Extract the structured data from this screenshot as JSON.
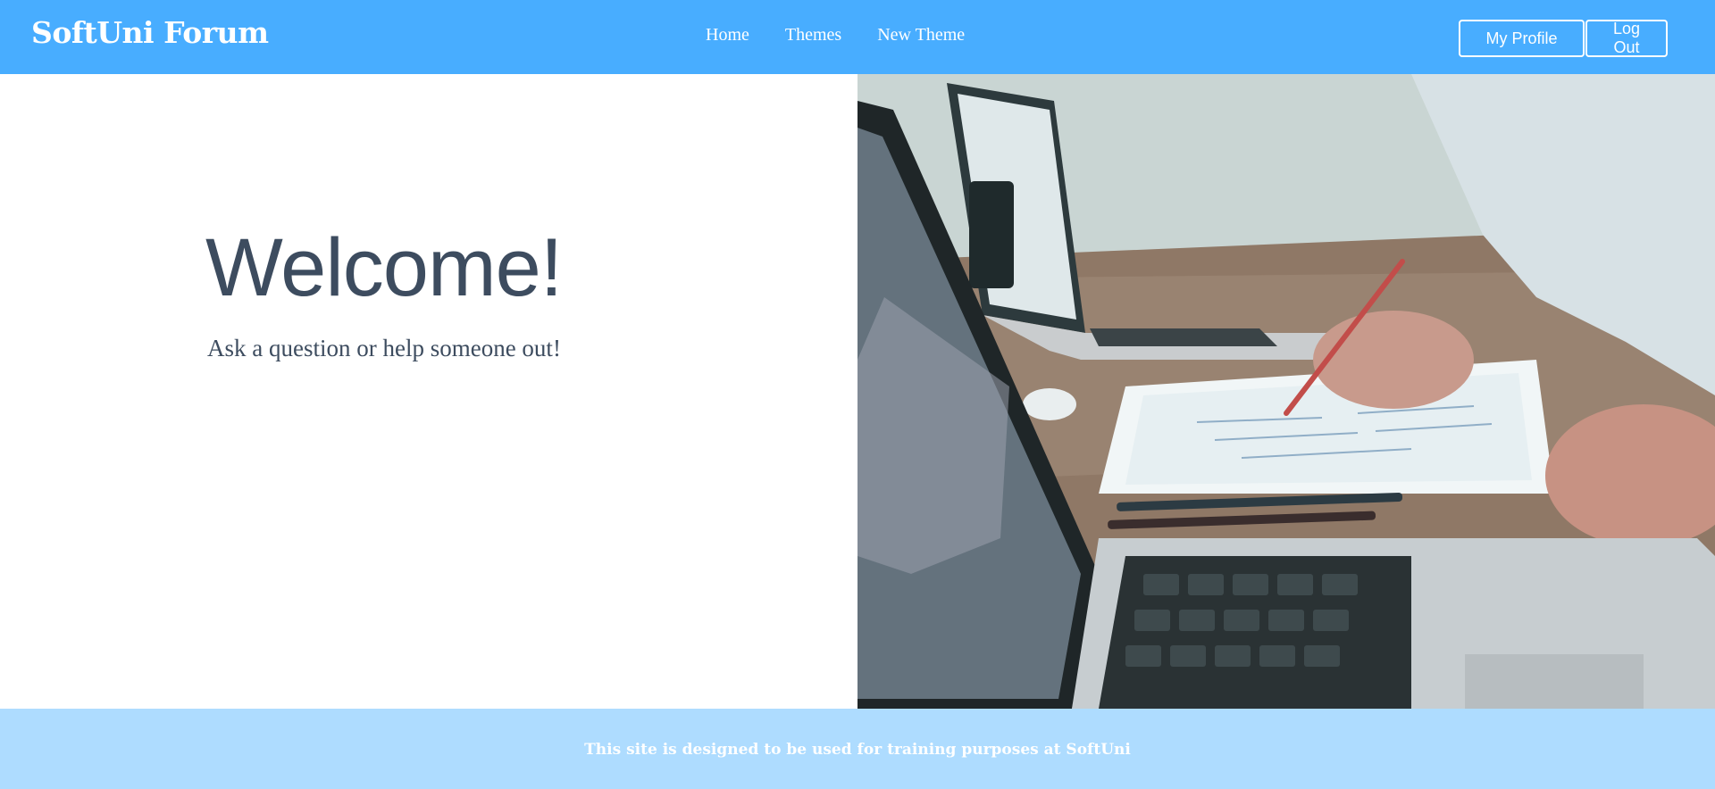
{
  "header": {
    "logo": "SoftUni Forum",
    "nav": [
      {
        "label": "Home"
      },
      {
        "label": "Themes"
      },
      {
        "label": "New Theme"
      }
    ],
    "buttons": {
      "profile": "My Profile",
      "logout": "Log Out"
    },
    "accent_color": "#48adff"
  },
  "hero": {
    "title": "Welcome!",
    "subtitle": "Ask a question or help someone out!",
    "image": "office-laptops-photo"
  },
  "footer": {
    "text": "This site is designed to be used for training purposes at SoftUni",
    "background_color": "#aedcff"
  }
}
